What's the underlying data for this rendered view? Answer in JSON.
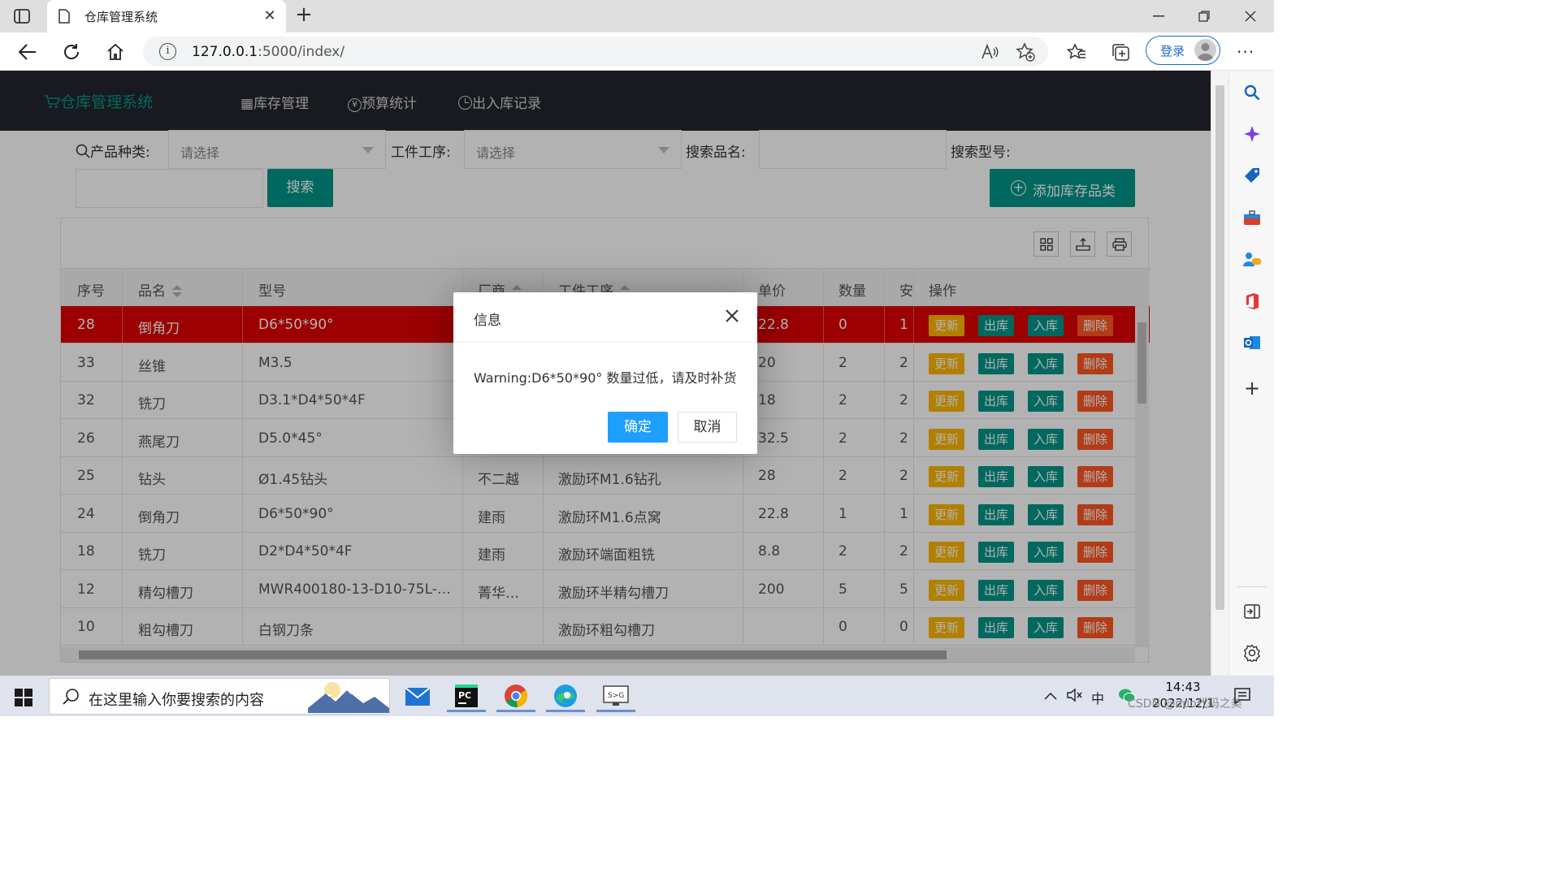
{
  "browser": {
    "tab_title": "仓库管理系统",
    "url_host": "127.0.0.1",
    "url_path": ":5000/index/",
    "login_label": "登录"
  },
  "app": {
    "logo": "仓库管理系统",
    "nav": [
      "库存管理",
      "预算统计",
      "出入库记录"
    ]
  },
  "filters": {
    "category_label": "产品种类:",
    "category_placeholder": "请选择",
    "process_label": "工件工序:",
    "process_placeholder": "请选择",
    "name_label": "搜索品名:",
    "model_label": "搜索型号:",
    "search_button": "搜索",
    "add_button": "添加库存品类"
  },
  "table": {
    "columns": [
      "序号",
      "品名",
      "型号",
      "厂商",
      "工件工序",
      "单价",
      "数量",
      "安",
      "操作"
    ],
    "actions": {
      "update": "更新",
      "out": "出库",
      "in": "入库",
      "delete": "删除"
    },
    "rows": [
      {
        "id": "28",
        "name": "倒角刀",
        "model": "D6*50*90°",
        "vendor": "",
        "process": "",
        "price": "22.8",
        "qty": "0",
        "safe": "1",
        "alert": true
      },
      {
        "id": "33",
        "name": "丝锥",
        "model": "M3.5",
        "vendor": "",
        "process": "",
        "price": "20",
        "qty": "2",
        "safe": "2",
        "alert": false
      },
      {
        "id": "32",
        "name": "铣刀",
        "model": "D3.1*D4*50*4F",
        "vendor": "",
        "process": "",
        "price": "18",
        "qty": "2",
        "safe": "2",
        "alert": false
      },
      {
        "id": "26",
        "name": "燕尾刀",
        "model": "D5.0*45°",
        "vendor": "",
        "process": "",
        "price": "32.5",
        "qty": "2",
        "safe": "2",
        "alert": false
      },
      {
        "id": "25",
        "name": "钻头",
        "model": "Ø1.45钻头",
        "vendor": "不二越",
        "process": "激励环M1.6钻孔",
        "price": "28",
        "qty": "2",
        "safe": "2",
        "alert": false
      },
      {
        "id": "24",
        "name": "倒角刀",
        "model": "D6*50*90°",
        "vendor": "建雨",
        "process": "激励环M1.6点窝",
        "price": "22.8",
        "qty": "1",
        "safe": "1",
        "alert": false
      },
      {
        "id": "18",
        "name": "铣刀",
        "model": "D2*D4*50*4F",
        "vendor": "建雨",
        "process": "激励环端面粗铣",
        "price": "8.8",
        "qty": "2",
        "safe": "2",
        "alert": false
      },
      {
        "id": "12",
        "name": "精勾槽刀",
        "model": "MWR400180-13-D10-75L-R…",
        "vendor": "菁华…",
        "process": "激励环半精勾槽刀",
        "price": "200",
        "qty": "5",
        "safe": "5",
        "alert": false
      },
      {
        "id": "10",
        "name": "粗勾槽刀",
        "model": "白钢刀条",
        "vendor": "",
        "process": "激励环粗勾槽刀",
        "price": "",
        "qty": "0",
        "safe": "0",
        "alert": false
      }
    ]
  },
  "dialog": {
    "title": "信息",
    "message": "Warning:D6*50*90° 数量过低，请及时补货",
    "ok": "确定",
    "cancel": "取消"
  },
  "taskbar": {
    "search_placeholder": "在这里输入你要搜索的内容",
    "time": "14:43",
    "date": "2022/12/1",
    "ime": "中",
    "watermark": "CSDN @duo代码之美"
  },
  "colors": {
    "header_bg": "#23262e",
    "brand": "#009688",
    "alert_row": "#e00000",
    "update": "#FFB800",
    "delete": "#FF5722",
    "dialog_ok": "#1E9FFF"
  }
}
